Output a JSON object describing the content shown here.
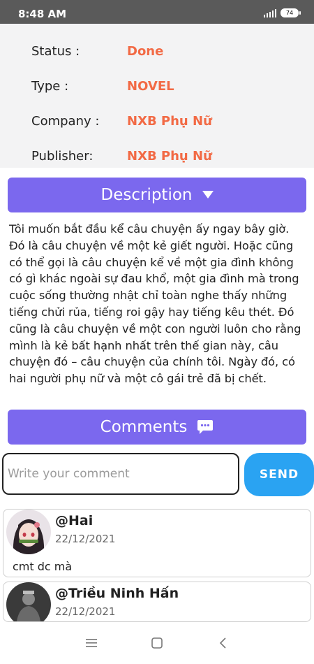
{
  "status_bar": {
    "time": "8:48 AM",
    "battery": "74"
  },
  "info": {
    "rows": [
      {
        "label": "Status :",
        "value": "Done"
      },
      {
        "label": "Type :",
        "value": "NOVEL"
      },
      {
        "label": "Company :",
        "value": "NXB Phụ Nữ"
      },
      {
        "label": "Publisher:",
        "value": "NXB Phụ Nữ"
      }
    ],
    "value_color": "#f26a45"
  },
  "description": {
    "label": "Description",
    "text": "Tôi muốn bắt đầu kể câu chuyện ấy ngay bây giờ. Đó là câu chuyện về một kẻ giết người. Hoặc cũng có thể gọi là câu chuyện kể về một gia đình không có gì khác ngoài sự đau khổ, một gia đình mà trong cuộc sống thường nhật chỉ toàn nghe thấy những tiếng chửi rủa, tiếng roi gậy hay tiếng kêu thét. Đó cũng là câu chuyện về một con người luôn cho rằng mình là kẻ bất hạnh nhất trên thế gian này, câu chuyện đó – câu chuyện của chính tôi. Ngày đó, có hai người phụ nữ và một cô gái trẻ đã bị chết."
  },
  "comments_section": {
    "label": "Comments",
    "input_placeholder": "Write your comment",
    "send_label": "SEND"
  },
  "comments": [
    {
      "name": "@Hai",
      "date": "22/12/2021",
      "body": "cmt dc mà"
    },
    {
      "name": "@Triều Ninh Hấn",
      "date": "22/12/2021",
      "body": ""
    }
  ],
  "colors": {
    "accent": "#7b68ee",
    "send": "#2aa3f2"
  }
}
